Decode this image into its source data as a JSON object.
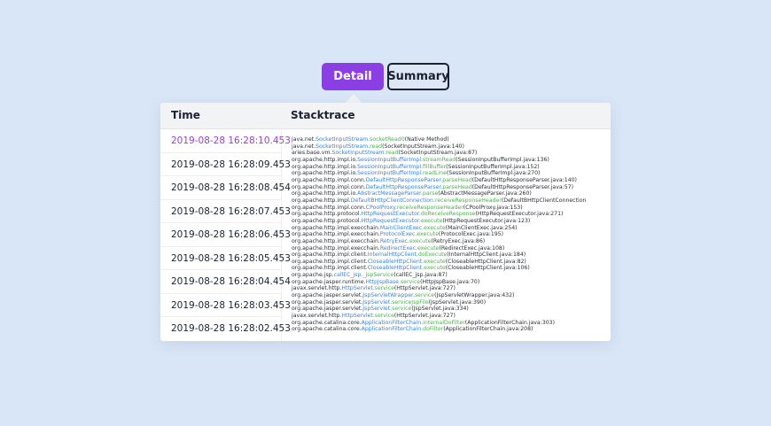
{
  "tabs": [
    {
      "label": "Detail",
      "active": true
    },
    {
      "label": "Summary",
      "active": false
    }
  ],
  "table": {
    "headers": {
      "time": "Time",
      "stacktrace": "Stacktrace"
    },
    "times": [
      "2019-08-28 16:28:10.453",
      "2019-08-28 16:28:09.453",
      "2019-08-28 16:28:08.454",
      "2019-08-28 16:28:07.453",
      "2019-08-28 16:28:06.453",
      "2019-08-28 16:28:05.453",
      "2019-08-28 16:28:04.454",
      "2019-08-28 16:28:03.453",
      "2019-08-28 16:28:02.453"
    ],
    "active_time_index": 0
  },
  "stacktrace": [
    [
      "java.net.",
      "SocketInputStream",
      "socketRead0",
      "(Native Method)"
    ],
    [
      "java.net.",
      "SocketInputStream",
      "read",
      "(SocketInputStream.java:140)"
    ],
    [
      "aries.base.vm.",
      "SocketInputStream",
      "read",
      "(SocketInputStream.java:87)"
    ],
    [
      "org.apache.http.impl.io.",
      "SessionInputBufferImpl",
      "streamRead",
      "(SessionInputBufferImpl.java:136)"
    ],
    [
      "org.apache.http.impl.io.",
      "SessionInputBufferImpl",
      "fillBuffer",
      "(SessionInputBufferImpl.java:152)"
    ],
    [
      "org.apache.http.impl.io.",
      "SessionInputBufferImpl",
      "readLine",
      "(SessionInputBufferImpl.java:270)"
    ],
    [
      "org.apache.http.impl.conn.",
      "DefaultHttpResponseParser",
      "parseHead",
      "(DefaultHttpResponseParser.java:140)"
    ],
    [
      "org.apache.http.impl.conn.",
      "DefaultHttpResponseParser",
      "parseHead",
      "(DefaultHttpResponseParser.java:57)"
    ],
    [
      "org.apache.http.impl.io.",
      "AbstractMessageParser",
      "parse",
      "(AbstractMessageParser.java:260)"
    ],
    [
      "org.apache.http.impl.",
      "DefaultBHttpClientConnection",
      "receiveResponseHeader",
      "(DefaultBHttpClientConnection"
    ],
    [
      "org.apache.http.impl.conn.",
      "CPoolProxy",
      "receiveResponseHeader",
      "(CPoolProxy.java:153)"
    ],
    [
      "org.apache.http.protocol.",
      "HttpRequestExecutor",
      "doReceiveResponse",
      "(HttpRequestExecutor.java:271)"
    ],
    [
      "org.apache.http.protocol.",
      "HttpRequestExecutor",
      "execute",
      "(HttpRequestExecutor.java:123)"
    ],
    [
      "org.apache.http.impl.execchain.",
      "MainClientExec",
      "execute",
      "(MainClientExec.java:254)"
    ],
    [
      "org.apache.http.impl.execchain.",
      "ProtocolExec",
      "execute",
      "(ProtocolExec.java:195)"
    ],
    [
      "org.apache.http.impl.execchain.",
      "RetryExec",
      "execute",
      "(RetryExec.java:86)"
    ],
    [
      "org.apache.http.impl.execchain.",
      "RedirectExec",
      "execute",
      "(RedirectExec.java:108)"
    ],
    [
      "org.apache.http.impl.client.",
      "InternalHttpClient",
      "doExecute",
      "(InternalHttpClient.java:184)"
    ],
    [
      "org.apache.http.impl.client.",
      "CloseableHttpClient",
      "execute",
      "(CloseableHttpClient.java:82)"
    ],
    [
      "org.apache.http.impl.client.",
      "CloseableHttpClient",
      "execute",
      "(CloseableHttpClient.java:106)"
    ],
    [
      "org.apache.jsp.",
      "callEC_jsp",
      "_jspService",
      "(callEC_jsp.java:87)"
    ],
    [
      "org.apache.jasper.runtime.",
      "HttpJspBase",
      "service",
      "(HttpJspBase.java:70)"
    ],
    [
      "javax.servlet.http.",
      "HttpServlet",
      "service",
      "(HttpServlet.java:727)"
    ],
    [
      "org.apache.jasper.servlet.",
      "JspServletWrapper",
      "service",
      "(JspServletWrapper.java:432)"
    ],
    [
      "org.apache.jasper.servlet.",
      "JspServlet",
      "serviceJspFile",
      "(JspServlet.java:390)"
    ],
    [
      "org.apache.jasper.servlet.",
      "JspServlet",
      "service",
      "(JspServlet.java:334)"
    ],
    [
      "javax.servlet.http.",
      "HttpServlet",
      "service",
      "(HttpServlet.java:727)"
    ],
    [
      "org.apache.catalina.core.",
      "ApplicationFilterChain",
      "internalDoFilter",
      "(ApplicationFilterChain.java:303)"
    ],
    [
      "org.apache.catalina.core.",
      "ApplicationFilterChain",
      "doFilter",
      "(ApplicationFilterChain.java:208)"
    ]
  ],
  "colors": {
    "background": "#d9e6f7",
    "tab_active": "#8a3ee3",
    "active_time": "#9b3fc6",
    "class_name": "#3b82d6",
    "method_name": "#4caf50"
  }
}
